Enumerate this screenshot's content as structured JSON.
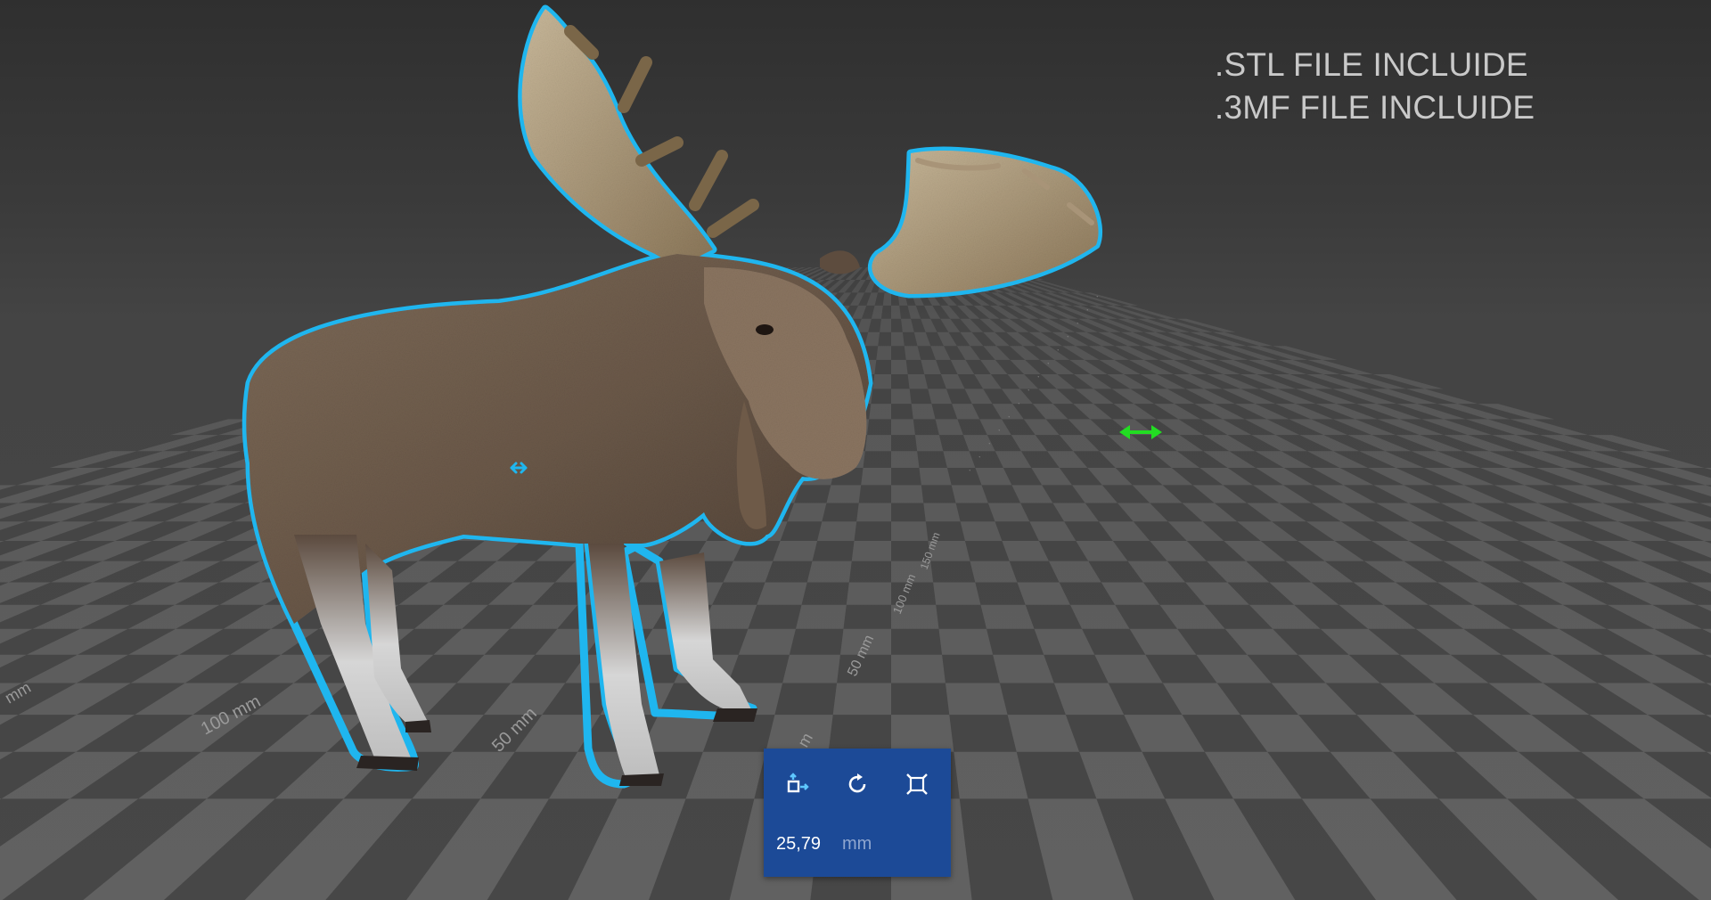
{
  "overlay": {
    "line1": ".STL FILE INCLUIDE",
    "line2": ".3MF FILE INCLUIDE"
  },
  "axis_labels": {
    "x_100": "100 mm",
    "x_50": "50 mm",
    "y_50": "50 mm",
    "y_100": "100 mm",
    "y_150": "150 mm",
    "edge": "mm",
    "panel_edge": "m"
  },
  "toolbar": {
    "move_icon": "move-icon",
    "rotate_icon": "rotate-icon",
    "scale_icon": "fit-scale-icon",
    "value": "25,79",
    "unit": "mm"
  },
  "colors": {
    "selection_outline": "#1fb6ef",
    "panel_bg": "#1c4a97",
    "gizmo_green": "#22dd22"
  }
}
